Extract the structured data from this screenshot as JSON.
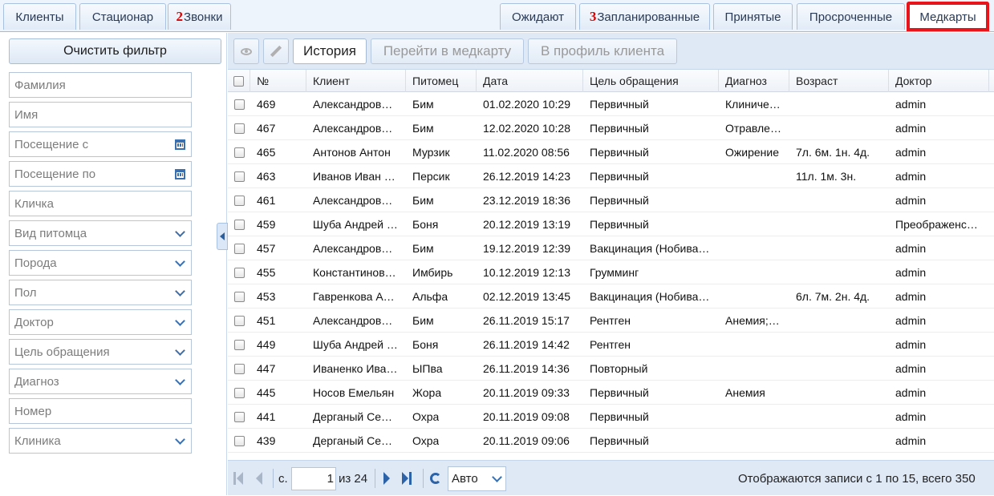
{
  "tabs_left": [
    {
      "label": "Клиенты"
    },
    {
      "label": "Стационар"
    },
    {
      "num": "2",
      "label": "Звонки"
    }
  ],
  "tabs_right": [
    {
      "label": "Ожидают"
    },
    {
      "num": "3",
      "label": "Запланированные"
    },
    {
      "label": "Принятые"
    },
    {
      "label": "Просроченные"
    },
    {
      "label": "Медкарты",
      "active": true
    }
  ],
  "filter": {
    "clear_label": "Очистить фильтр",
    "fields": [
      {
        "placeholder": "Фамилия",
        "icon": ""
      },
      {
        "placeholder": "Имя",
        "icon": ""
      },
      {
        "placeholder": "Посещение с",
        "icon": "calendar-icon"
      },
      {
        "placeholder": "Посещение по",
        "icon": "calendar-icon"
      },
      {
        "placeholder": "Кличка",
        "icon": ""
      },
      {
        "placeholder": "Вид питомца",
        "icon": "chevron-down-icon"
      },
      {
        "placeholder": "Порода",
        "icon": "chevron-down-icon"
      },
      {
        "placeholder": "Пол",
        "icon": "chevron-down-icon"
      },
      {
        "placeholder": "Доктор",
        "icon": "chevron-down-icon"
      },
      {
        "placeholder": "Цель обращения",
        "icon": "chevron-down-icon"
      },
      {
        "placeholder": "Диагноз",
        "icon": "chevron-down-icon"
      },
      {
        "placeholder": "Номер",
        "icon": ""
      },
      {
        "placeholder": "Клиника",
        "icon": "chevron-down-icon"
      }
    ]
  },
  "toolbar": {
    "view_icon": "eye-icon",
    "edit_icon": "pencil-icon",
    "history_label": "История",
    "medcard_label": "Перейти в медкарту",
    "profile_label": "В профиль клиента"
  },
  "grid": {
    "columns": [
      "№",
      "Клиент",
      "Питомец",
      "Дата",
      "Цель обращения",
      "Диагноз",
      "Возраст",
      "Доктор"
    ],
    "rows": [
      [
        "469",
        "Александров…",
        "Бим",
        "01.02.2020 10:29",
        "Первичный",
        "Клиниче…",
        "",
        "admin"
      ],
      [
        "467",
        "Александров…",
        "Бим",
        "12.02.2020 10:28",
        "Первичный",
        "Отравле…",
        "",
        "admin"
      ],
      [
        "465",
        "Антонов Антон",
        "Мурзик",
        "11.02.2020 08:56",
        "Первичный",
        "Ожирение",
        "7л. 6м. 1н. 4д.",
        "admin"
      ],
      [
        "463",
        "Иванов Иван …",
        "Персик",
        "26.12.2019 14:23",
        "Первичный",
        "",
        "11л. 1м. 3н.",
        "admin"
      ],
      [
        "461",
        "Александров…",
        "Бим",
        "23.12.2019 18:36",
        "Первичный",
        "",
        "",
        "admin"
      ],
      [
        "459",
        "Шуба Андрей …",
        "Боня",
        "20.12.2019 13:19",
        "Первичный",
        "",
        "",
        "Преображенс…"
      ],
      [
        "457",
        "Александров…",
        "Бим",
        "19.12.2019 12:39",
        "Вакцинация (Нобива…",
        "",
        "",
        "admin"
      ],
      [
        "455",
        "Константинов…",
        "Имбирь",
        "10.12.2019 12:13",
        "Грумминг",
        "",
        "",
        "admin"
      ],
      [
        "453",
        "Гавренкова А…",
        "Альфа",
        "02.12.2019 13:45",
        "Вакцинация (Нобива…",
        "",
        "6л. 7м. 2н. 4д.",
        "admin"
      ],
      [
        "451",
        "Александров…",
        "Бим",
        "26.11.2019 15:17",
        "Рентген",
        "Анемия;…",
        "",
        "admin"
      ],
      [
        "449",
        "Шуба Андрей …",
        "Боня",
        "26.11.2019 14:42",
        "Рентген",
        "",
        "",
        "admin"
      ],
      [
        "447",
        "Иваненко Ива…",
        "ЫПва",
        "26.11.2019 14:36",
        "Повторный",
        "",
        "",
        "admin"
      ],
      [
        "445",
        "Носов Емельян",
        "Жора",
        "20.11.2019 09:33",
        "Первичный",
        "Анемия",
        "",
        "admin"
      ],
      [
        "441",
        "Дерганый Се…",
        "Охра",
        "20.11.2019 09:08",
        "Первичный",
        "",
        "",
        "admin"
      ],
      [
        "439",
        "Дерганый Се…",
        "Охра",
        "20.11.2019 09:06",
        "Первичный",
        "",
        "",
        "admin"
      ]
    ]
  },
  "pager": {
    "page_prefix": "с.",
    "page_value": "1",
    "of_label": "из 24",
    "page_size": "Авто",
    "summary": "Отображаются записи с 1 по 15, всего 350"
  }
}
